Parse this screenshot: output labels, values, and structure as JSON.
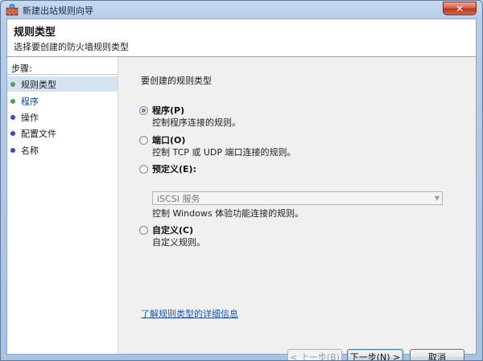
{
  "window": {
    "title": "新建出站规则向导",
    "close_glyph": "✕"
  },
  "header": {
    "title": "规则类型",
    "subtitle": "选择要创建的防火墙规则类型"
  },
  "sidebar": {
    "steps_label": "步骤:",
    "items": [
      {
        "label": "规则类型",
        "bullet_color": "#44a84a",
        "state": "current"
      },
      {
        "label": "程序",
        "bullet_color": "#44a84a",
        "state": "next"
      },
      {
        "label": "操作",
        "bullet_color": "#2f4fb5",
        "state": "pending"
      },
      {
        "label": "配置文件",
        "bullet_color": "#2f4fb5",
        "state": "pending"
      },
      {
        "label": "名称",
        "bullet_color": "#2f4fb5",
        "state": "pending"
      }
    ]
  },
  "main": {
    "prompt": "要创建的规则类型",
    "options": [
      {
        "label": "程序(P)",
        "description": "控制程序连接的规则。",
        "checked": true
      },
      {
        "label": "端口(O)",
        "description": "控制 TCP 或 UDP 端口连接的规则。",
        "checked": false
      },
      {
        "label": "预定义(E):",
        "description": "控制 Windows 体验功能连接的规则。",
        "checked": false
      },
      {
        "label": "自定义(C)",
        "description": "自定义规则。",
        "checked": false
      }
    ],
    "predefined_select": {
      "value": "iSCSI 服务",
      "arrow": "▼"
    },
    "help_link": "了解规则类型的详细信息"
  },
  "buttons": {
    "back": "< 上一步(B)",
    "next": "下一步(N) >",
    "cancel": "取消"
  },
  "icons": {
    "app": "firewall-wall-icon",
    "close": "close-icon"
  }
}
